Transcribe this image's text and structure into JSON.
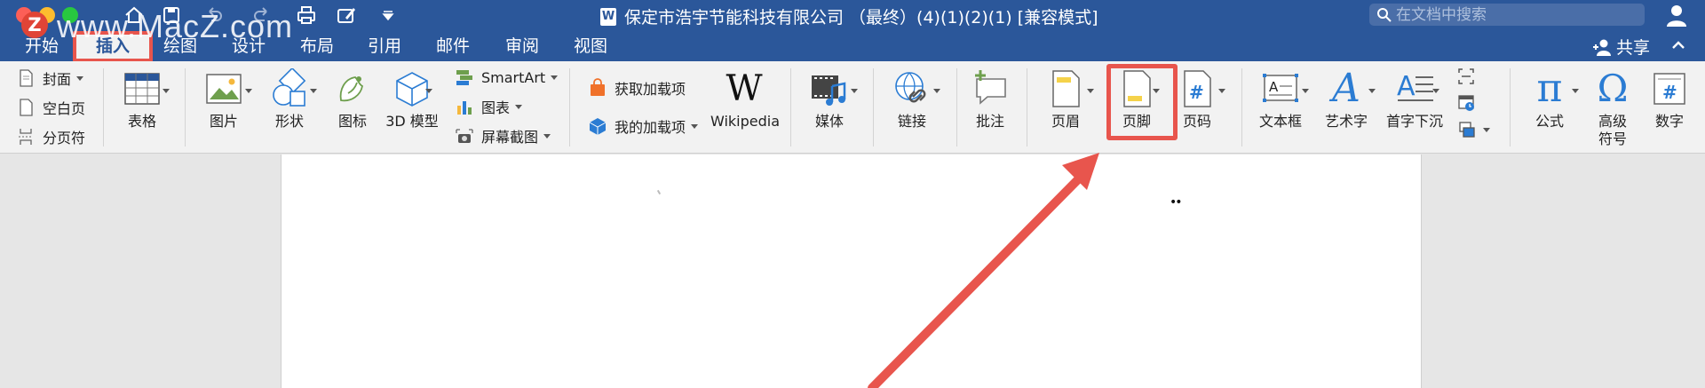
{
  "watermark": {
    "badge": "Z",
    "text": "www.MacZ.com"
  },
  "window": {
    "title": "保定市浩宇节能科技有限公司 （最终）(4)(1)(2)(1) [兼容模式]",
    "app_badge": "W",
    "search_placeholder": "在文档中搜索"
  },
  "tabs": [
    {
      "label": "开始"
    },
    {
      "label": "插入",
      "active": true
    },
    {
      "label": "绘图"
    },
    {
      "label": "设计"
    },
    {
      "label": "布局"
    },
    {
      "label": "引用"
    },
    {
      "label": "邮件"
    },
    {
      "label": "审阅"
    },
    {
      "label": "视图"
    }
  ],
  "share_label": "共享",
  "ribbon": {
    "pages": {
      "cover": "封面",
      "blank": "空白页",
      "break": "分页符"
    },
    "table": "表格",
    "illustrations": {
      "pictures": "图片",
      "shapes": "形状",
      "icons": "图标",
      "models": "3D 模型"
    },
    "smart": {
      "smartart": "SmartArt",
      "chart": "图表",
      "screenshot": "屏幕截图"
    },
    "addins": {
      "get": "获取加载项",
      "mine": "我的加载项",
      "wikipedia": "Wikipedia",
      "wiki_glyph": "W"
    },
    "media": "媒体",
    "link": "链接",
    "comment": "批注",
    "header": "页眉",
    "footer": "页脚",
    "page_number": "页码",
    "textbox": "文本框",
    "wordart": "艺术字",
    "dropcap": "首字下沉",
    "equation": "公式",
    "symbol": "高级\n符号",
    "symbol_line1": "高级",
    "symbol_line2": "符号",
    "number": "数字"
  },
  "document": {
    "dots": "••"
  },
  "colors": {
    "brand": "#2b579a",
    "ribbon_bg": "#f2f2f2",
    "highlight": "#e8554d"
  }
}
